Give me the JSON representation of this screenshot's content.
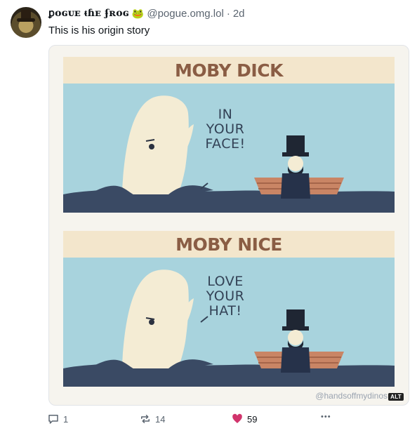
{
  "post": {
    "author_name": "ꝑoɢᴜᴇ ᵵɦᴇ ʄʀoɢ",
    "author_emoji": "🐸",
    "handle": "@pogue.omg.lol",
    "separator": "·",
    "time": "2d",
    "text": "This is his origin story"
  },
  "media": {
    "panel1_title": "MOBY DICK",
    "panel1_speech": [
      "IN",
      "YOUR",
      "FACE!"
    ],
    "panel2_title": "MOBY NICE",
    "panel2_speech": [
      "LOVE",
      "YOUR",
      "HAT!"
    ],
    "credit": "@handsoffmydinos",
    "alt_label": "ALT"
  },
  "actions": {
    "reply_count": "1",
    "repost_count": "14",
    "like_count": "59",
    "more_label": "•••"
  },
  "colors": {
    "like": "#d1346c",
    "banner": "#f3e6cc",
    "sky": "#a8d3dd",
    "sea": "#3a4a64"
  },
  "icons": [
    "reply-icon",
    "repost-icon",
    "heart-icon",
    "more-icon"
  ]
}
